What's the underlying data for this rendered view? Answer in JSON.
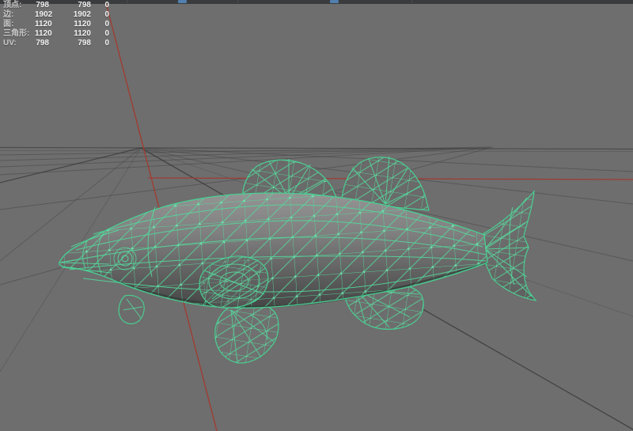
{
  "toolbar": {
    "background": "#3a3b3d",
    "accent_color": "#517fae"
  },
  "stats": {
    "rows": [
      {
        "label": "顶点:",
        "v1": "798",
        "v2": "798",
        "v3": "0"
      },
      {
        "label": "边:",
        "v1": "1902",
        "v2": "1902",
        "v3": "0"
      },
      {
        "label": "面:",
        "v1": "1120",
        "v2": "1120",
        "v3": "0"
      },
      {
        "label": "三角形:",
        "v1": "1120",
        "v2": "1120",
        "v3": "0"
      },
      {
        "label": "UV:",
        "v1": "798",
        "v2": "798",
        "v3": "0"
      }
    ]
  },
  "viewport": {
    "background_color": "#6e6e6e",
    "grid_color": "#3f3f3f",
    "axis_color": "#a23a30",
    "model": "fish",
    "wireframe_color": "#55d89c",
    "vertex_color": "#8df0c2",
    "body_shading_top": "#929292",
    "body_shading_bottom": "#474747"
  }
}
